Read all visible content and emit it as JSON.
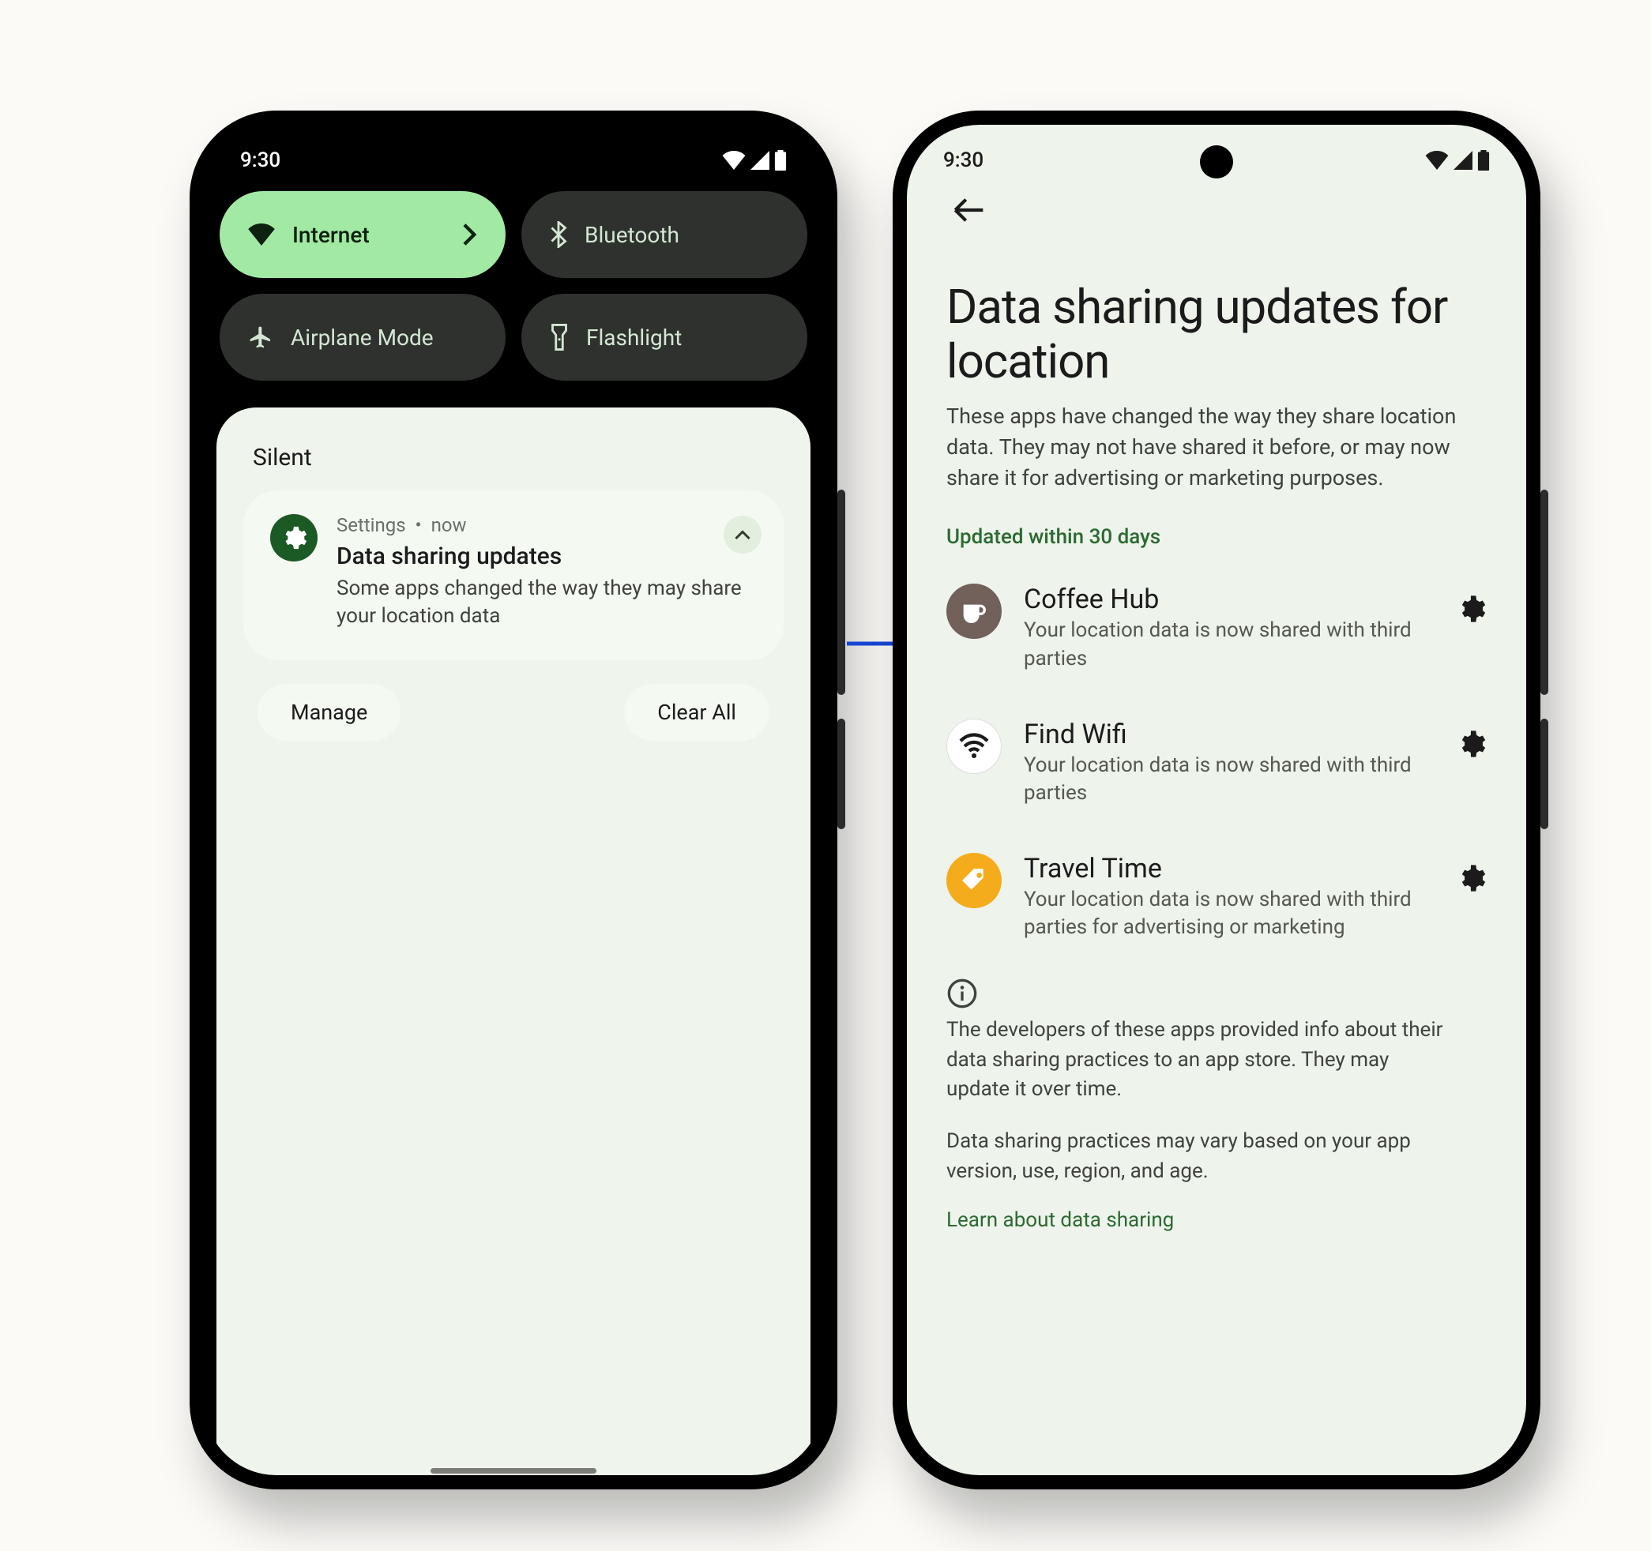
{
  "status": {
    "time": "9:30"
  },
  "qs": {
    "internet": "Internet",
    "bluetooth": "Bluetooth",
    "airplane": "Airplane Mode",
    "flashlight": "Flashlight"
  },
  "shade": {
    "silent": "Silent",
    "notif": {
      "app": "Settings",
      "sep": "•",
      "time": "now",
      "title": "Data sharing updates",
      "body": "Some apps changed the way they may share your location data"
    },
    "manage": "Manage",
    "clear": "Clear All"
  },
  "detail": {
    "title": "Data sharing updates for location",
    "subtitle": "These apps have changed the way they share location data. They may not have shared it before, or may now share it for advertising or marketing purposes.",
    "section": "Updated within 30 days",
    "apps": [
      {
        "name": "Coffee Hub",
        "desc": "Your location data is now shared with third parties"
      },
      {
        "name": "Find Wifi",
        "desc": "Your location data is now shared with third parties"
      },
      {
        "name": "Travel Time",
        "desc": "Your location data is now shared with third parties for advertising or marketing"
      }
    ],
    "foot1": "The developers of these apps provided info about their data sharing practices to an app store. They may update it over time.",
    "foot2": "Data sharing practices may vary based on your app version, use, region, and age.",
    "learn": "Learn about data sharing"
  },
  "icons": {
    "coffee_bg": "#71615a",
    "wifi_bg": "#ffffff",
    "travel_bg": "#f4ac1c"
  }
}
